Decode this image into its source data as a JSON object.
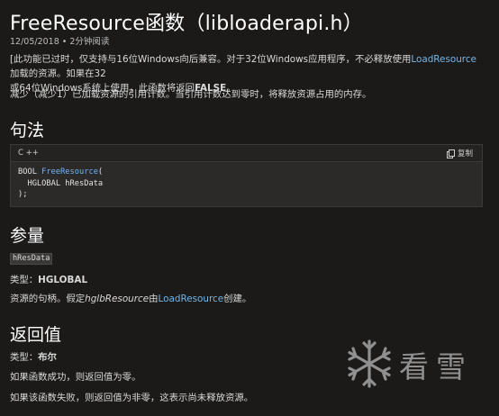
{
  "page": {
    "title": "FreeResource函数（libloaderapi.h）",
    "date": "12/05/2018",
    "dot": "•",
    "read_time": "2分钟阅读",
    "intro": {
      "t1": "[此功能已过时，仅支持与16位Windows向后兼容。对于32位Windows应用程序，不必释放使用",
      "link": "LoadResource",
      "t2": "加载的资源。如果在32",
      "line2": "或64位Windows系统上使用，此函数将返回",
      "false_word": "FALSE",
      "t3": "。"
    },
    "desc": "减少（减少1）已加载资源的引用计数。当引用计数达到零时，将释放资源占用的内存。",
    "syntax": {
      "heading": "句法",
      "lang": "C ++",
      "copy_label": "复制",
      "code_line1_prefix": "BOOL ",
      "code_line1_fn": "FreeResource",
      "code_line1_suffix": "(",
      "code_line2": "  HGLOBAL hResData",
      "code_line3": ");"
    },
    "params": {
      "heading": "参量",
      "name": "hResData",
      "type_label": "类型：",
      "type_value": "HGLOBAL",
      "desc_t1": "资源的句柄。假定",
      "desc_ital": "hglbResource",
      "desc_t2": "由",
      "desc_link": "LoadResource",
      "desc_t3": "创建。"
    },
    "returns": {
      "heading": "返回值",
      "type_label": "类型：",
      "type_value": "布尔",
      "success": "如果函数成功，则返回值为零。",
      "failure": "如果该函数失败，则返回值为非零，这表示尚未释放资源。"
    },
    "watermark": {
      "text": "看雪",
      "icon": "snowflake-logo"
    }
  }
}
